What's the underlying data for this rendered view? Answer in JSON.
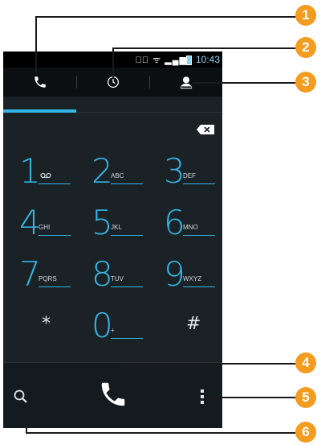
{
  "statusbar": {
    "time": "10:43",
    "icons": "◂ﾟ ᯤ ▂▄▆"
  },
  "tabs": [
    {
      "name": "phone-tab",
      "icon": "phone-icon"
    },
    {
      "name": "recent-tab",
      "icon": "clock-icon"
    },
    {
      "name": "contacts-tab",
      "icon": "person-icon"
    }
  ],
  "keypad": [
    {
      "digit": "1",
      "letters": ""
    },
    {
      "digit": "2",
      "letters": "ABC"
    },
    {
      "digit": "3",
      "letters": "DEF"
    },
    {
      "digit": "4",
      "letters": "GHI"
    },
    {
      "digit": "5",
      "letters": "JKL"
    },
    {
      "digit": "6",
      "letters": "MNO"
    },
    {
      "digit": "7",
      "letters": "PQRS"
    },
    {
      "digit": "8",
      "letters": "TUV"
    },
    {
      "digit": "9",
      "letters": "WXYZ"
    },
    {
      "digit": "*",
      "letters": ""
    },
    {
      "digit": "0",
      "letters": "+"
    },
    {
      "digit": "#",
      "letters": ""
    }
  ],
  "callouts": [
    "1",
    "2",
    "3",
    "4",
    "5",
    "6"
  ],
  "colors": {
    "accent": "#33b5e5",
    "callout": "#f39c1f",
    "background": "#1a2226"
  }
}
